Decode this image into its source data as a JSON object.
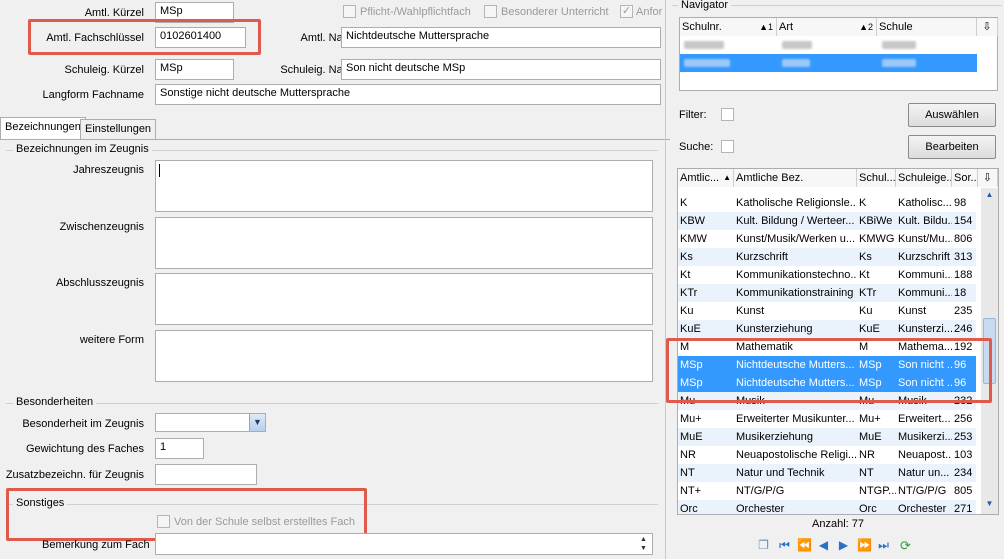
{
  "form": {
    "amtl_kuerzel_label": "Amtl. Kürzel",
    "amtl_kuerzel_value": "MSp",
    "pflicht_label": "Pflicht-/Wahlpflichtfach",
    "besonderer_label": "Besonderer Unterricht",
    "anfor_label": "Anfor",
    "fachschluessel_label": "Amtl. Fachschlüssel",
    "fachschluessel_value": "0102601400",
    "amtl_name_label": "Amtl. Name",
    "amtl_name_value": "Nichtdeutsche Muttersprache",
    "schuleig_kuerzel_label": "Schuleig. Kürzel",
    "schuleig_kuerzel_value": "MSp",
    "schuleig_name_label": "Schuleig. Name",
    "schuleig_name_value": "Son nicht deutsche MSp",
    "langform_label": "Langform Fachname",
    "langform_value": "Sonstige nicht deutsche Muttersprache"
  },
  "tabs": [
    "Bezeichnungen",
    "Einstellungen"
  ],
  "zeugnis": {
    "group_title": "Bezeichnungen im Zeugnis",
    "jahres": "Jahreszeugnis",
    "zwischen": "Zwischenzeugnis",
    "abschluss": "Abschlusszeugnis",
    "weitere": "weitere Form"
  },
  "besonderheiten": {
    "group_title": "Besonderheiten",
    "besonderheit_label": "Besonderheit im Zeugnis",
    "gewichtung_label": "Gewichtung des Faches",
    "gewichtung_value": "1",
    "zusatz_label": "Zusatzbezeichn. für Zeugnis"
  },
  "sonstiges": {
    "group_title": "Sonstiges",
    "checkbox_label": "Von der Schule selbst erstelltes Fach",
    "bemerkung_label": "Bemerkung zum Fach"
  },
  "navigator": {
    "title": "Navigator",
    "columns": [
      "Schulnr.",
      "Art",
      "Schule"
    ],
    "filter_label": "Filter:",
    "suche_label": "Suche:",
    "auswaehlen": "Auswählen",
    "bearbeiten": "Bearbeiten",
    "grid_columns": [
      "Amtlic...",
      "Amtliche Bez.",
      "Schul...",
      "Schuleige...",
      "Sor..."
    ],
    "rows": [
      [
        "K",
        "Katholische Religionsle...",
        "K",
        "Katholisc...",
        "98"
      ],
      [
        "KBW",
        "Kult. Bildung / Werteer...",
        "KBiWe",
        "Kult. Bildu...",
        "154"
      ],
      [
        "KMW",
        "Kunst/Musik/Werken u...",
        "KMWG",
        "Kunst/Mu...",
        "806"
      ],
      [
        "Ks",
        "Kurzschrift",
        "Ks",
        "Kurzschrift",
        "313"
      ],
      [
        "Kt",
        "Kommunikationstechno...",
        "Kt",
        "Kommuni...",
        "188"
      ],
      [
        "KTr",
        "Kommunikationstraining",
        "KTr",
        "Kommuni...",
        "18"
      ],
      [
        "Ku",
        "Kunst",
        "Ku",
        "Kunst",
        "235"
      ],
      [
        "KuE",
        "Kunsterziehung",
        "KuE",
        "Kunsterzi...",
        "246"
      ],
      [
        "M",
        "Mathematik",
        "M",
        "Mathema...",
        "192"
      ],
      [
        "MSp",
        "Nichtdeutsche Mutters...",
        "MSp",
        "Son nicht ...",
        "96"
      ],
      [
        "MSp",
        "Nichtdeutsche Mutters...",
        "MSp",
        "Son nicht ...",
        "96"
      ],
      [
        "Mu",
        "Musik",
        "Mu",
        "Musik",
        "232"
      ],
      [
        "Mu+",
        "Erweiterter Musikunter...",
        "Mu+",
        "Erweitert...",
        "256"
      ],
      [
        "MuE",
        "Musikerziehung",
        "MuE",
        "Musikerzi...",
        "253"
      ],
      [
        "NR",
        "Neuapostolische Religi...",
        "NR",
        "Neuapost...",
        "103"
      ],
      [
        "NT",
        "Natur und Technik",
        "NT",
        "Natur un...",
        "234"
      ],
      [
        "NT+",
        "NT/G/P/G",
        "NTGP...",
        "NT/G/P/G",
        "805"
      ],
      [
        "Orc",
        "Orchester",
        "Orc",
        "Orchester",
        "271"
      ]
    ],
    "anzahl": "Anzahl: 77"
  }
}
